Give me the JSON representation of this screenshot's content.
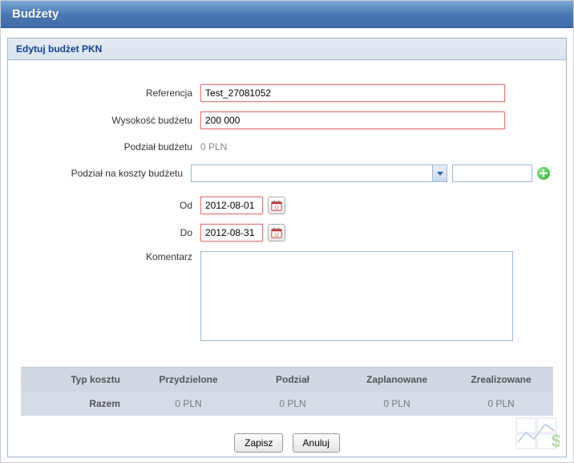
{
  "header": {
    "title": "Budżety"
  },
  "panel": {
    "title": "Edytuj budżet PKN"
  },
  "form": {
    "reference_label": "Referencja",
    "reference_value": "Test_27081052",
    "amount_label": "Wysokość budżetu",
    "amount_value": "200 000",
    "division_label": "Podział budżetu",
    "division_value": "0 PLN",
    "cost_split_label": "Podział na koszty budżetu",
    "date_from_label": "Od",
    "date_from_value": "2012-08-01",
    "date_to_label": "Do",
    "date_to_value": "2012-08-31",
    "comment_label": "Komentarz",
    "comment_value": ""
  },
  "table": {
    "headers": {
      "col1": "Typ kosztu",
      "col2": "Przydzielone",
      "col3": "Podział",
      "col4": "Zaplanowane",
      "col5": "Zrealizowane"
    },
    "row": {
      "col1": "Razem",
      "col2": "0 PLN",
      "col3": "0 PLN",
      "col4": "0 PLN",
      "col5": "0 PLN"
    }
  },
  "buttons": {
    "save": "Zapisz",
    "cancel": "Anuluj"
  }
}
